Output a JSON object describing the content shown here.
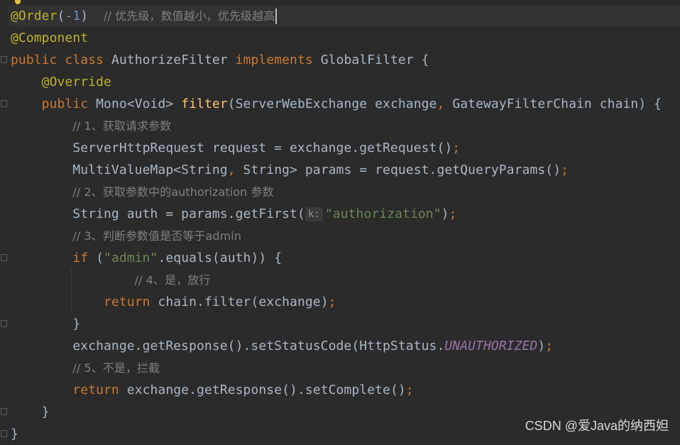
{
  "code": {
    "l1": {
      "ann": "@Order",
      "p1": "(",
      "num": "-1",
      "p2": ")  ",
      "cmt": "// 优先级，数值越小，优先级越高"
    },
    "l2": {
      "ann": "@Component"
    },
    "l3": {
      "kw1": "public",
      "kw2": "class",
      "name": "AuthorizeFilter",
      "kw3": "implements",
      "iface": "GlobalFilter {"
    },
    "l4": {
      "ann": "@Override"
    },
    "l5": {
      "kw": "public",
      "ret": "Mono<Void> ",
      "fn": "filter",
      "a1": "(ServerWebExchange exchange",
      "comma": ",",
      "a2": " GatewayFilterChain chain) {"
    },
    "l6": {
      "cmt": "// 1、获取请求参数"
    },
    "l7": {
      "code": "ServerHttpRequest request = exchange.getRequest()",
      "semi": ";"
    },
    "l8": {
      "c1": "MultiValueMap<String",
      "comma": ",",
      "c2": " String> params = request.getQueryParams()",
      "semi": ";"
    },
    "l9": {
      "cmt": "// 2、获取参数中的authorization 参数"
    },
    "l10": {
      "c1": "String auth = params.getFirst(",
      "hint": "k:",
      "str": "\"authorization\"",
      "c2": ")",
      "semi": ";"
    },
    "l11": {
      "cmt": "// 3、判断参数值是否等于admin"
    },
    "l12": {
      "kw": "if",
      "c1": " (",
      "str": "\"admin\"",
      "c2": ".equals(auth)) {"
    },
    "l13": {
      "cmt": "// 4、是，放行"
    },
    "l14": {
      "kw": "return",
      "c1": " chain.filter(exchange)",
      "semi": ";"
    },
    "l15": {
      "c1": "}"
    },
    "l16": {
      "c1": "exchange.getResponse().setStatusCode(HttpStatus.",
      "const": "UNAUTHORIZED",
      "c2": ")",
      "semi": ";"
    },
    "l17": {
      "cmt": "// 5、不是，拦截"
    },
    "l18": {
      "kw": "return",
      "c1": " exchange.getResponse().setComplete()",
      "semi": ";"
    },
    "l19": {
      "c1": "}"
    },
    "l20": {
      "c1": "}"
    }
  },
  "watermark": "CSDN @爱Java的纳西妲",
  "colors": {
    "background": "#2b2b2b",
    "annotation": "#bbb529",
    "keyword": "#cc7832",
    "number": "#6897bb",
    "comment": "#808080",
    "string": "#6a8759",
    "method": "#ffc66d",
    "constant": "#9876aa",
    "text": "#a9b7c6"
  },
  "icons": [
    "lightbulb-icon",
    "fold-icon"
  ]
}
